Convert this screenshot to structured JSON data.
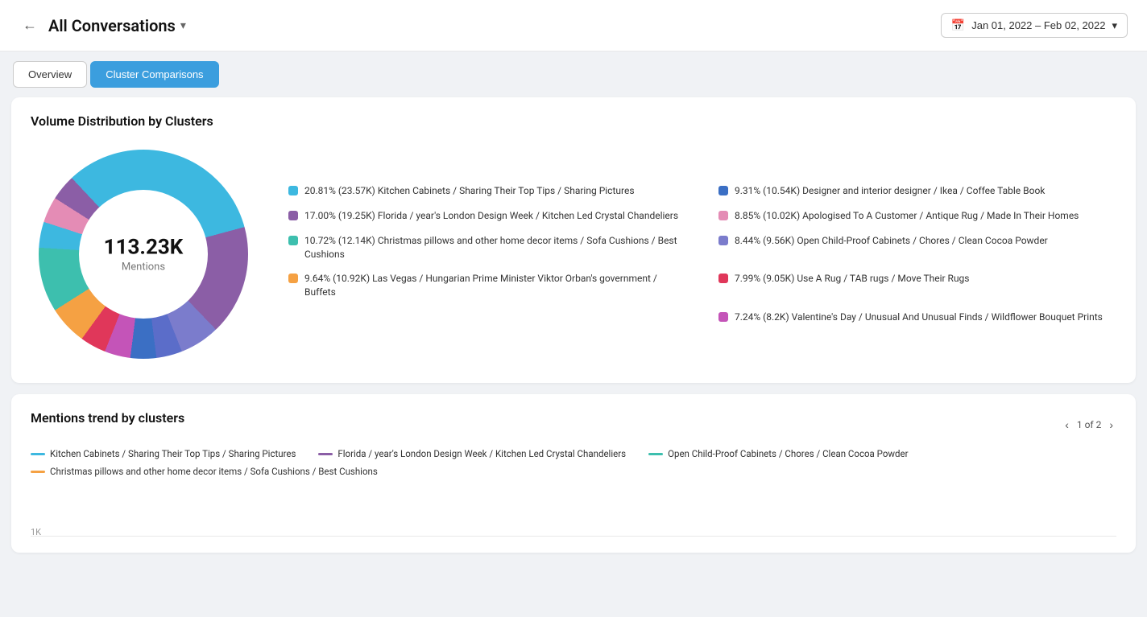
{
  "header": {
    "back_label": "←",
    "title": "All Conversations",
    "title_chevron": "▾",
    "date_range": "Jan 01, 2022 – Feb 02, 2022",
    "date_chevron": "▾",
    "calendar_icon": "📅"
  },
  "tabs": [
    {
      "id": "overview",
      "label": "Overview",
      "active": false
    },
    {
      "id": "cluster-comparisons",
      "label": "Cluster Comparisons",
      "active": true
    }
  ],
  "volume_section": {
    "title": "Volume Distribution by Clusters",
    "donut": {
      "center_value": "113.23K",
      "center_label": "Mentions"
    },
    "segments": [
      {
        "color": "#3db8e0",
        "pct": 20.81,
        "label": "20.81% (23.57K) Kitchen Cabinets / Sharing Their Top Tips / Sharing Pictures"
      },
      {
        "color": "#8b5ea6",
        "pct": 17.0,
        "label": "17.00% (19.25K) Florida / year's London Design Week / Kitchen Led Crystal Chandeliers"
      },
      {
        "color": "#3dbfae",
        "pct": 10.72,
        "label": "10.72% (12.14K) Christmas pillows and other home decor items / Sofa Cushions / Best Cushions"
      },
      {
        "color": "#f5a143",
        "pct": 9.64,
        "label": "9.64% (10.92K) Las Vegas / Hungarian Prime Minister Viktor Orban's government / Buffets"
      },
      {
        "color": "#3b6fc4",
        "pct": 9.31,
        "label": "9.31% (10.54K) Designer and interior designer / Ikea / Coffee Table Book"
      },
      {
        "color": "#e48cb5",
        "pct": 8.85,
        "label": "8.85% (10.02K) Apologised To A Customer / Antique Rug / Made In Their Homes"
      },
      {
        "color": "#7b7ccc",
        "pct": 8.44,
        "label": "8.44% (9.56K) Open Child-Proof Cabinets / Chores / Clean Cocoa Powder"
      },
      {
        "color": "#e0375a",
        "pct": 7.99,
        "label": "7.99% (9.05K) Use A Rug / TAB rugs / Move Their Rugs"
      },
      {
        "color": "#c454b8",
        "pct": 7.24,
        "label": "7.24% (8.2K) Valentine's Day / Unusual And Unusual Finds / Wildflower Bouquet Prints"
      }
    ]
  },
  "trend_section": {
    "title": "Mentions trend by clusters",
    "pagination": "1 of 2",
    "legend": [
      {
        "color": "#3db8e0",
        "label": "Kitchen Cabinets / Sharing Their Top Tips / Sharing Pictures"
      },
      {
        "color": "#8b5ea6",
        "label": "Florida / year's London Design Week / Kitchen Led Crystal Chandeliers"
      },
      {
        "color": "#3dbfae",
        "label": "Open Child-Proof Cabinets / Chores / Clean Cocoa Powder"
      },
      {
        "color": "#f5a143",
        "label": "Christmas pillows and other home decor items / Sofa Cushions / Best Cushions"
      }
    ],
    "y_label": "1K"
  }
}
